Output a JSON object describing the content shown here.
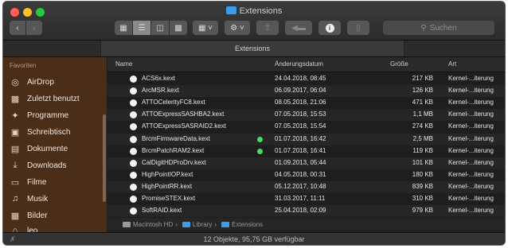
{
  "window": {
    "title": "Extensions",
    "tab_label": "Extensions",
    "search_placeholder": "Suchen",
    "traffic_lights": [
      "#ff5f57",
      "#febc2e",
      "#28c840"
    ],
    "status_text": "12 Objekte, 95,75 GB verfügbar"
  },
  "toolbar": {
    "back_icon": "chevron-left-icon",
    "forward_icon": "chevron-right-icon",
    "view_buttons": [
      "icon-view-icon",
      "list-view-icon",
      "column-view-icon",
      "gallery-view-icon"
    ],
    "arrange_icon": "grid-icon",
    "action_icon": "gear-icon",
    "share_icon": "share-icon",
    "tag_icon": "tag-icon",
    "info_icon": "info-icon",
    "delete_icon": "trash-icon"
  },
  "sidebar": {
    "header": "Favoriten",
    "items": [
      {
        "label": "AirDrop",
        "icon": "airdrop-icon"
      },
      {
        "label": "Zuletzt benutzt",
        "icon": "recents-icon"
      },
      {
        "label": "Programme",
        "icon": "applications-icon"
      },
      {
        "label": "Schreibtisch",
        "icon": "desktop-icon"
      },
      {
        "label": "Dokumente",
        "icon": "documents-icon"
      },
      {
        "label": "Downloads",
        "icon": "downloads-icon"
      },
      {
        "label": "Filme",
        "icon": "movies-icon"
      },
      {
        "label": "Musik",
        "icon": "music-icon"
      },
      {
        "label": "Bilder",
        "icon": "pictures-icon"
      },
      {
        "label": "leo",
        "icon": "home-icon"
      }
    ]
  },
  "columns": [
    "Name",
    "Änderungsdatum",
    "Größe",
    "Art"
  ],
  "rows": [
    {
      "name": "ACS6x.kext",
      "date": "24.04.2018, 08:45",
      "size": "217 KB",
      "kind": "Kernel-...iterung",
      "tag": false
    },
    {
      "name": "ArcMSR.kext",
      "date": "06.09.2017, 06:04",
      "size": "126 KB",
      "kind": "Kernel-...iterung",
      "tag": false
    },
    {
      "name": "ATTOCelerityFC8.kext",
      "date": "08.05.2018, 21:06",
      "size": "471 KB",
      "kind": "Kernel-...iterung",
      "tag": false
    },
    {
      "name": "ATTOExpressSASHBA2.kext",
      "date": "07.05.2018, 15:53",
      "size": "1,1 MB",
      "kind": "Kernel-...iterung",
      "tag": false
    },
    {
      "name": "ATTOExpressSASRAID2.kext",
      "date": "07.05.2018, 15:54",
      "size": "274 KB",
      "kind": "Kernel-...iterung",
      "tag": false
    },
    {
      "name": "BrcmFirmwareData.kext",
      "date": "01.07.2018, 16:42",
      "size": "2,5 MB",
      "kind": "Kernel-...iterung",
      "tag": true
    },
    {
      "name": "BrcmPatchRAM2.kext",
      "date": "01.07.2018, 16:41",
      "size": "119 KB",
      "kind": "Kernel-...iterung",
      "tag": true
    },
    {
      "name": "CalDigitHDProDrv.kext",
      "date": "01.09.2013, 05:44",
      "size": "101 KB",
      "kind": "Kernel-...iterung",
      "tag": false
    },
    {
      "name": "HighPointIOP.kext",
      "date": "04.05.2018, 00:31",
      "size": "180 KB",
      "kind": "Kernel-...iterung",
      "tag": false
    },
    {
      "name": "HighPointRR.kext",
      "date": "05.12.2017, 10:48",
      "size": "839 KB",
      "kind": "Kernel-...iterung",
      "tag": false
    },
    {
      "name": "PromiseSTEX.kext",
      "date": "31.03.2017, 11:11",
      "size": "310 KB",
      "kind": "Kernel-...iterung",
      "tag": false
    },
    {
      "name": "SoftRAID.kext",
      "date": "25.04.2018, 02:09",
      "size": "979 KB",
      "kind": "Kernel-...iterung",
      "tag": false
    }
  ],
  "pathbar": [
    "Macintosh HD",
    "Library",
    "Extensions"
  ],
  "colors": {
    "tag_green": "#4cd964",
    "folder_blue": "#3d9be9",
    "sidebar_bg": "#4a2e18"
  }
}
